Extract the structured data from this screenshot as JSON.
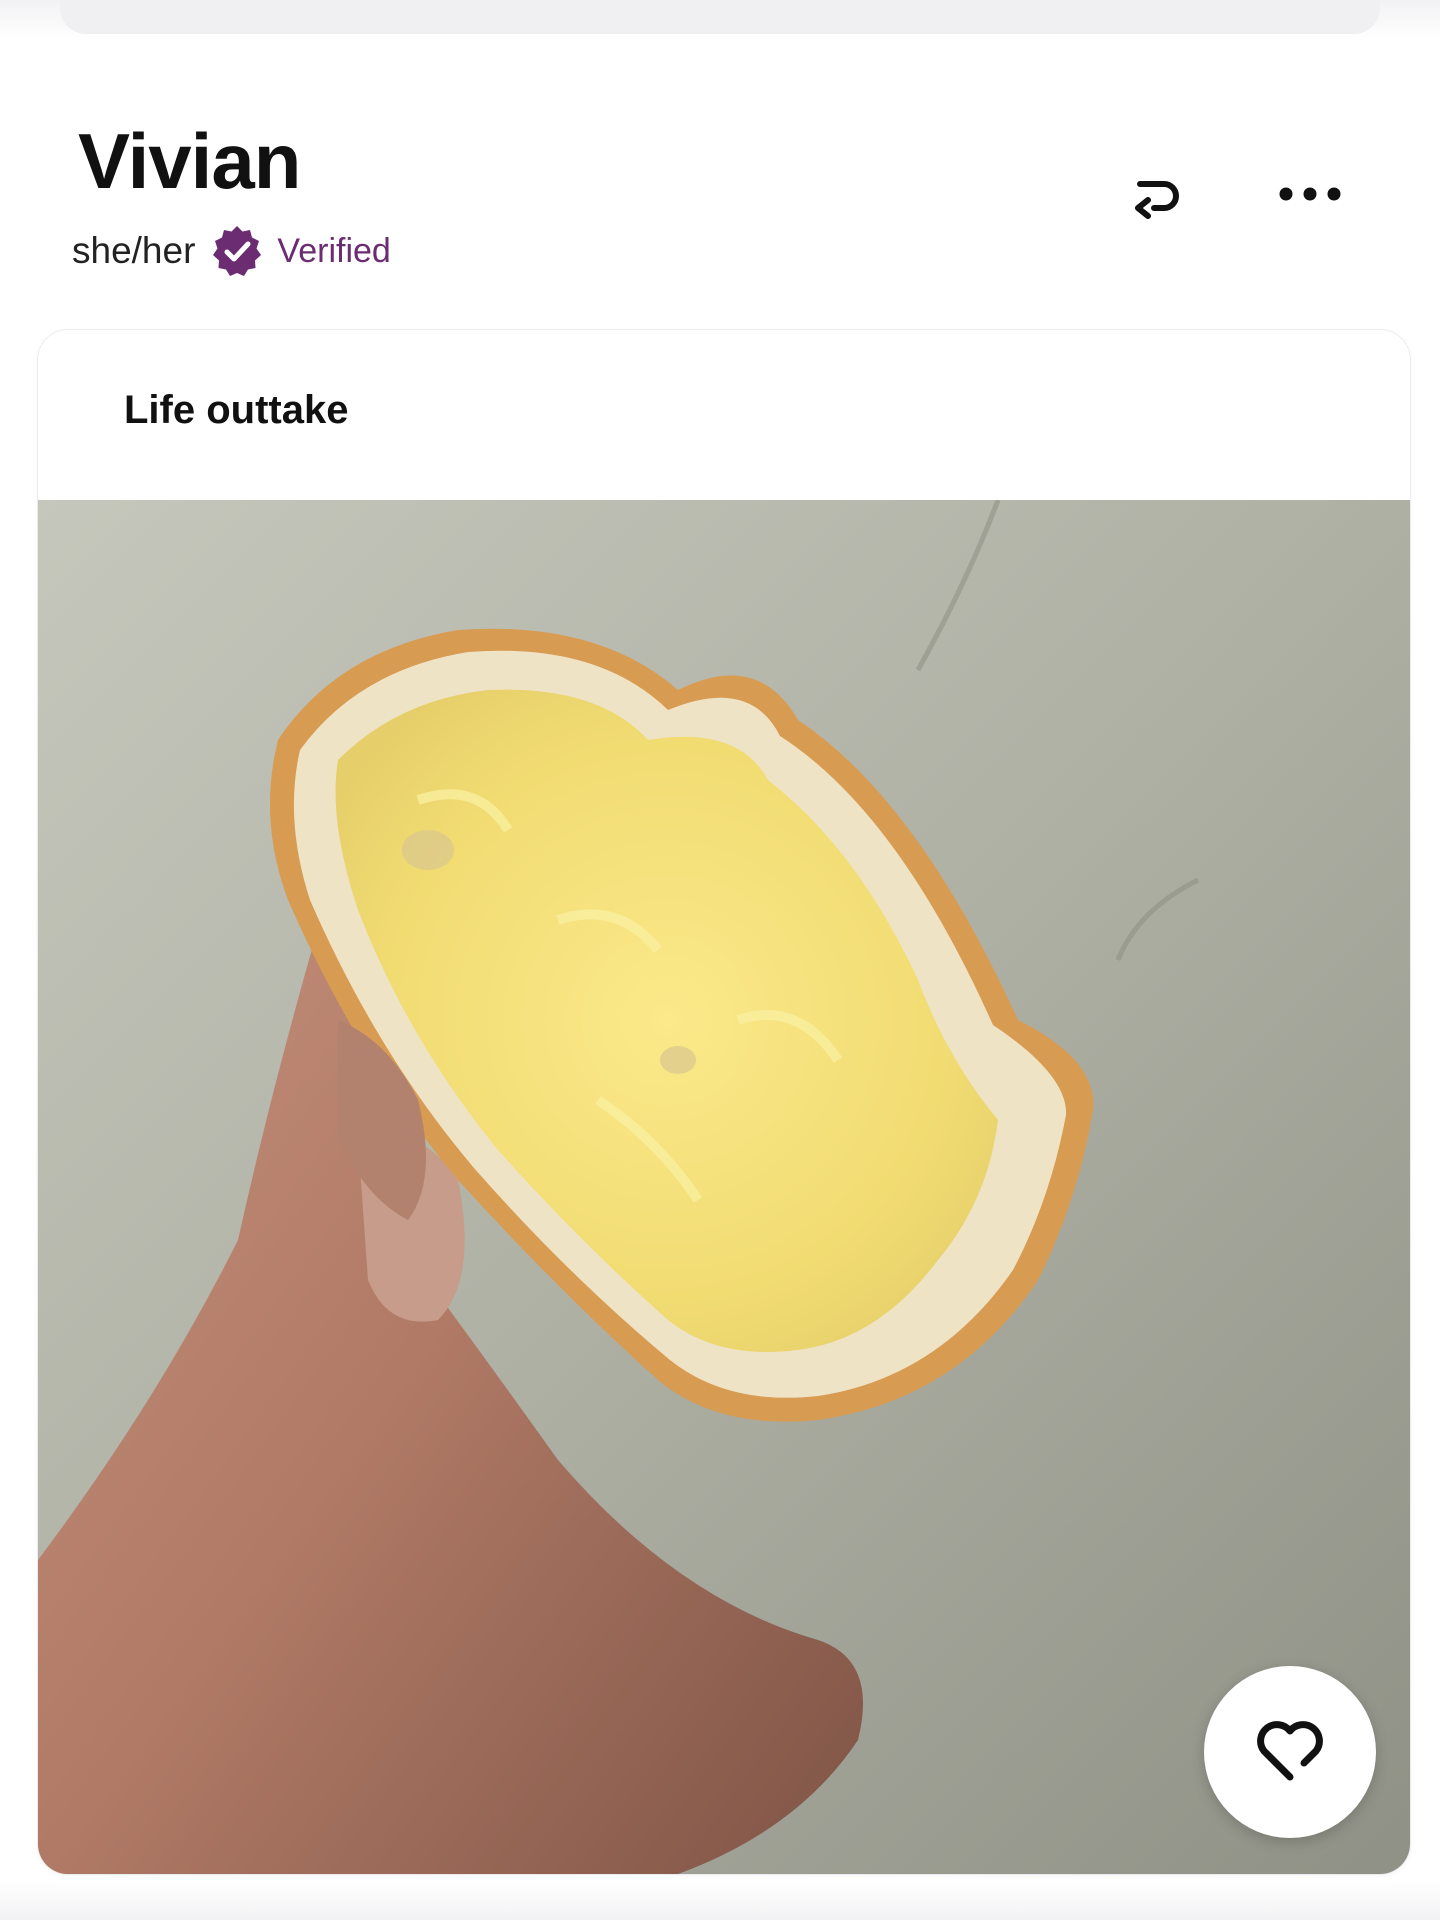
{
  "profile": {
    "name": "Vivian",
    "pronouns": "she/her",
    "verified_label": "Verified",
    "verified_color": "#6b2c72"
  },
  "header_actions": {
    "undo_icon": "undo-arrow-icon",
    "more_icon": "more-dots-icon"
  },
  "prompt_card": {
    "title": "Life outtake",
    "photo_subject": "hand holding a slice of bread spread with butter",
    "like_icon": "heart-icon"
  }
}
